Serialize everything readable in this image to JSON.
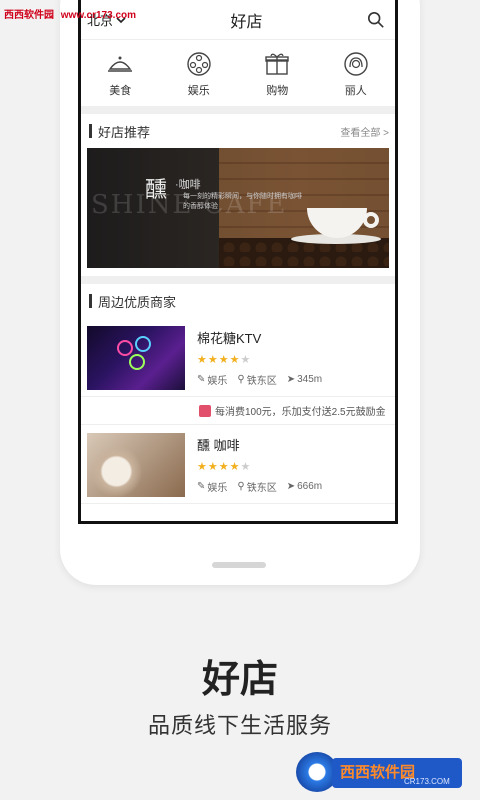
{
  "watermark": {
    "site_name": "西西软件园",
    "url": "www.cr173.com"
  },
  "header": {
    "city": "北京",
    "title": "好店"
  },
  "categories": [
    {
      "label": "美食",
      "icon": "food-dish-icon"
    },
    {
      "label": "娱乐",
      "icon": "film-reel-icon"
    },
    {
      "label": "购物",
      "icon": "gift-box-icon"
    },
    {
      "label": "丽人",
      "icon": "beauty-woman-icon"
    }
  ],
  "recommend": {
    "title": "好店推荐",
    "more": "查看全部 >",
    "banner": {
      "brand_big": "醺",
      "brand_small": "·咖啡",
      "slogan": "每一刻的精彩瞬间，与你随时拥有咖啡的香醇体验",
      "bg_text": "SHINE CAFE"
    }
  },
  "nearby": {
    "title": "周边优质商家",
    "shops": [
      {
        "name": "棉花糖KTV",
        "rating": 4,
        "category": "娱乐",
        "area": "铁东区",
        "distance": "345m",
        "promo": "每消费100元，乐加支付送2.5元鼓励金"
      },
      {
        "name": "醺 咖啡",
        "rating": 4,
        "category": "娱乐",
        "area": "铁东区",
        "distance": "666m"
      }
    ]
  },
  "caption": {
    "title": "好店",
    "subtitle": "品质线下生活服务"
  },
  "logo": {
    "cn": "西西软件园",
    "en": "CR173.COM"
  },
  "colors": {
    "star": "#f2b01e",
    "promo_tag": "#e24f6b",
    "watermark": "#d0021b"
  }
}
